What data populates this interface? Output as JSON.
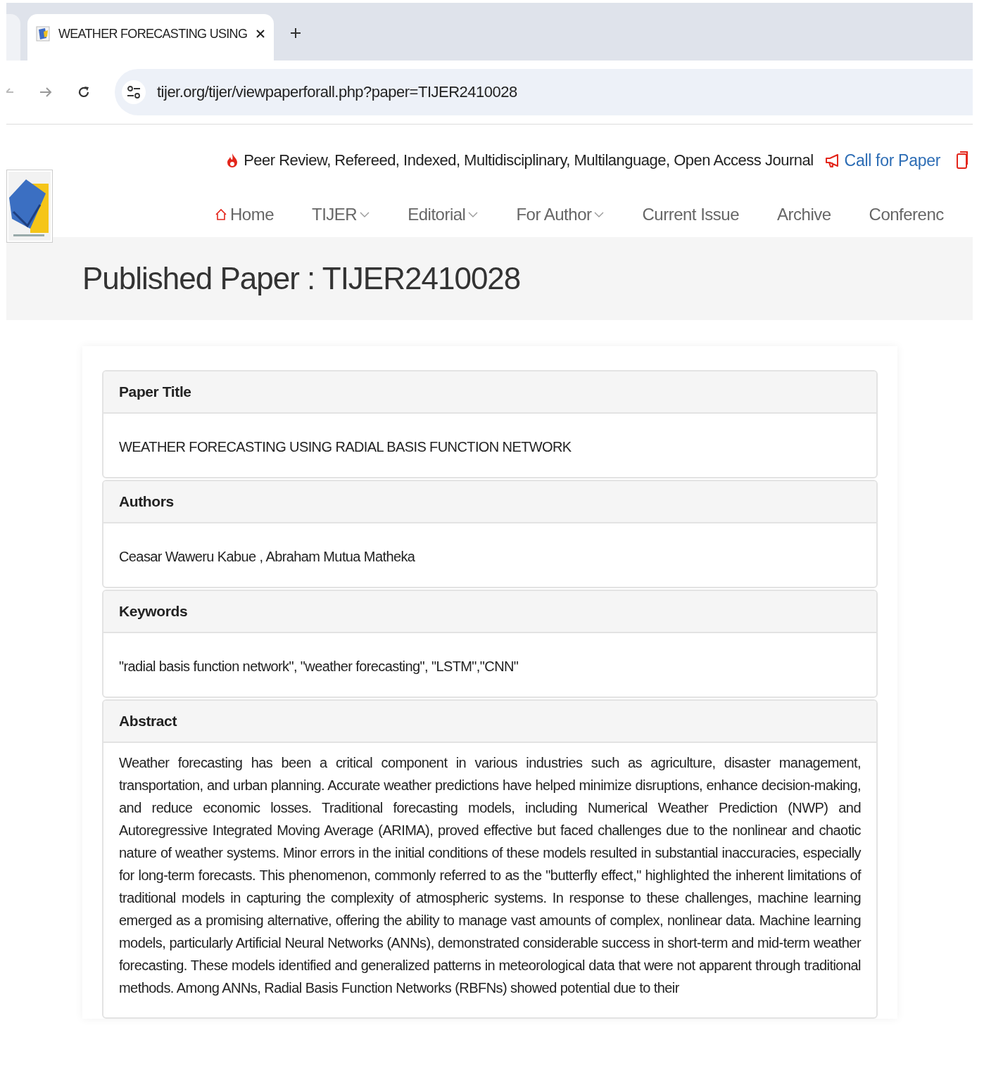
{
  "browser": {
    "tabs": [
      {
        "title": "WEATHER FORECASTING USING",
        "selected": true
      }
    ],
    "address": {
      "url": "tijer.org/tijer/viewpaperforall.php?paper=TIJER2410028"
    }
  },
  "site": {
    "tagline": "Peer Review, Refereed, Indexed, Multidisciplinary, Multilanguage, Open Access Journal",
    "call_link": "Call for Paper",
    "nav": [
      {
        "label": "Home",
        "kind": "home",
        "has_menu": false
      },
      {
        "label": "TIJER",
        "kind": "plain",
        "has_menu": true
      },
      {
        "label": "Editorial",
        "kind": "plain",
        "has_menu": true
      },
      {
        "label": "For Author",
        "kind": "plain",
        "has_menu": true
      },
      {
        "label": "Current Issue",
        "kind": "plain",
        "has_menu": false
      },
      {
        "label": "Archive",
        "kind": "plain",
        "has_menu": false
      },
      {
        "label": "Conferenc",
        "kind": "plain",
        "has_menu": false
      }
    ]
  },
  "page_title": "Published Paper : TIJER2410028",
  "sections": [
    {
      "heading": "Paper Title",
      "body": "WEATHER FORECASTING USING RADIAL BASIS FUNCTION NETWORK"
    },
    {
      "heading": "Authors",
      "body": "Ceasar Waweru Kabue , Abraham Mutua Matheka"
    },
    {
      "heading": "Keywords",
      "body": "\"radial basis function network\", \"weather forecasting\", \"LSTM\",\"CNN\""
    },
    {
      "heading": "Abstract",
      "body": "Weather forecasting has been a critical component in various industries such as agriculture, disaster management, transportation, and urban planning. Accurate weather predictions have helped minimize disruptions, enhance decision-making, and reduce economic losses. Traditional forecasting models, including Numerical Weather Prediction (NWP) and Autoregressive Integrated Moving Average (ARIMA), proved effective but faced challenges due to the nonlinear and chaotic nature of weather systems. Minor errors in the initial conditions of these models resulted in substantial inaccuracies, especially for long-term forecasts. This phenomenon, commonly referred to as the \"butterfly effect,\" highlighted the inherent limitations of traditional models in capturing the complexity of atmospheric systems. In response to these challenges, machine learning emerged as a promising alternative, offering the ability to manage vast amounts of complex, nonlinear data. Machine learning models, particularly Artificial Neural Networks (ANNs), demonstrated considerable success in short-term and mid-term weather forecasting. These models identified and generalized patterns in meteorological data that were not apparent through traditional methods. Among ANNs, Radial Basis Function Networks (RBFNs) showed potential due to their"
    }
  ]
}
